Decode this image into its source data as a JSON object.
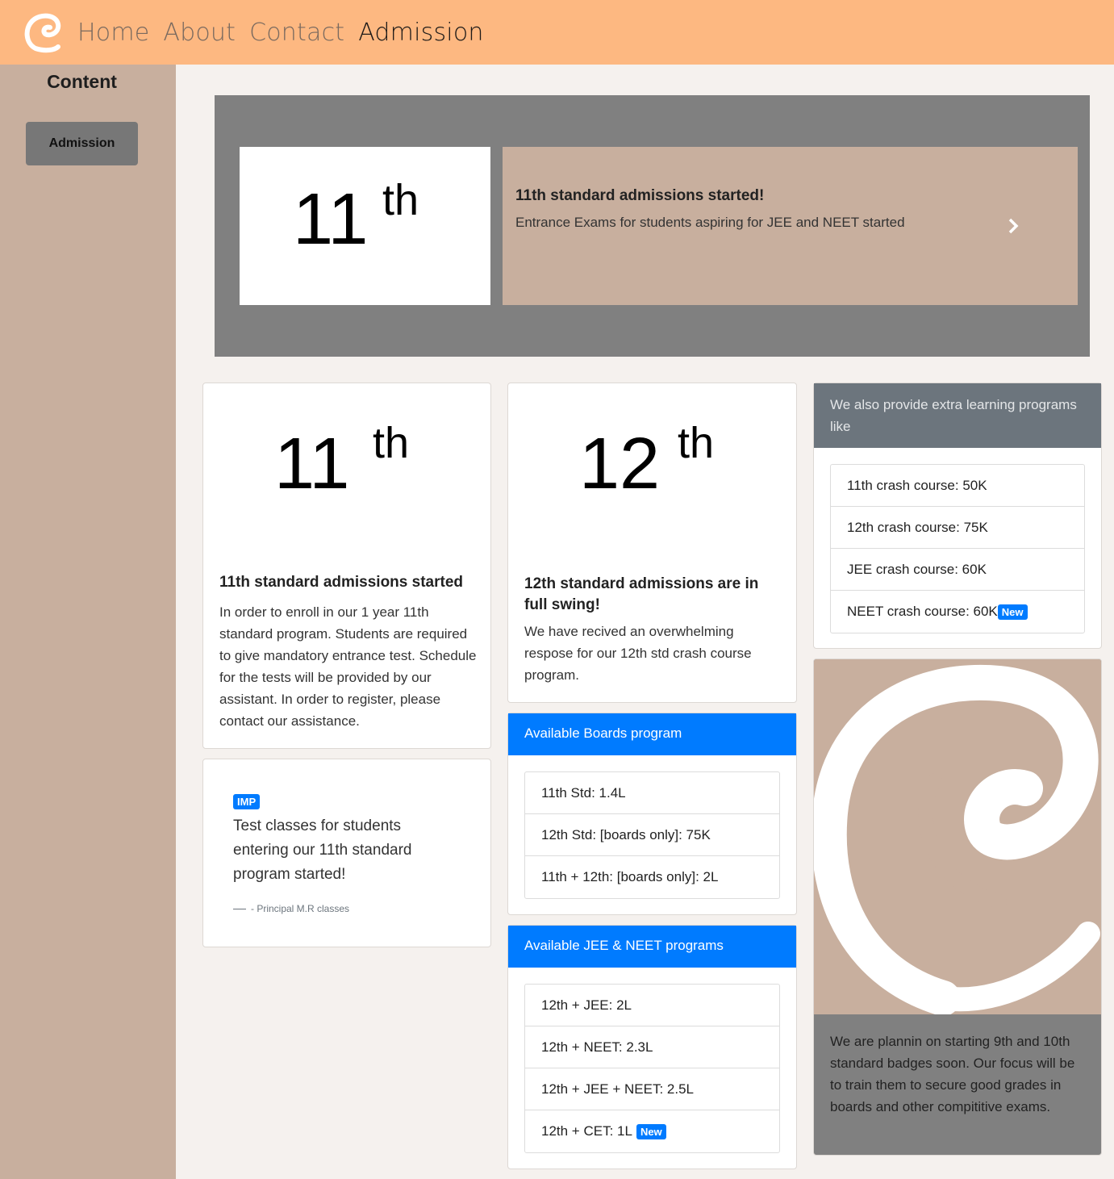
{
  "navbar": {
    "logo_icon": "brand-swirl-logo",
    "links": [
      "Home",
      "About",
      "Contact",
      "Admission"
    ],
    "active": "Admission"
  },
  "sidebar": {
    "title": "Content",
    "button": "Admission"
  },
  "carousel": {
    "image_number": "11",
    "image_suffix": "th",
    "title": "11th standard admissions started!",
    "text": "Entrance Exams for students aspiring for JEE and NEET started",
    "next_icon": "chevron-right-icon"
  },
  "card11": {
    "image_number": "11",
    "image_suffix": "th",
    "title": "11th standard admissions started",
    "text": "In order to enroll in our 1 year 11th standard program. Students are required to give mandatory entrance test. Schedule for the tests will be provided by our assistant. In order to register, please contact our assistance."
  },
  "quote": {
    "badge": "IMP",
    "text": "Test classes for students entering our 11th standard program started!",
    "footer": "- Principal M.R classes"
  },
  "card12": {
    "image_number": "12",
    "image_suffix": "th",
    "title": "12th standard admissions are in full swing!",
    "text": "We have recived an overwhelming respose for our 12th std crash course program."
  },
  "boards": {
    "header": "Available Boards program",
    "items": [
      "11th Std: 1.4L",
      "12th Std: [boards only]: 75K",
      "11th + 12th: [boards only]: 2L"
    ]
  },
  "jee_neet": {
    "header": "Available JEE & NEET programs",
    "items": [
      "12th + JEE: 2L",
      "12th + NEET: 2.3L",
      "12th + JEE + NEET: 2.5L",
      "12th + CET: 1L"
    ],
    "badge": "New"
  },
  "extra": {
    "header": "We also provide extra learning programs like",
    "items": [
      "11th crash course: 50K",
      "12th crash course: 75K",
      "JEE crash course: 60K",
      "NEET crash course: 60K"
    ],
    "badge": "New"
  },
  "future": {
    "image_icon": "brand-swirl-logo",
    "text": "We are plannin on starting 9th and 10th standard badges soon. Our focus will be to train them to secure good grades in boards and other compititive exams."
  },
  "colors": {
    "navbar": "#fdb881",
    "sidebar": "#c8af9e",
    "carousel_bg": "#808080",
    "badge": "#007bff",
    "blue_header": "#007bff",
    "gray_header": "#6c757d"
  }
}
